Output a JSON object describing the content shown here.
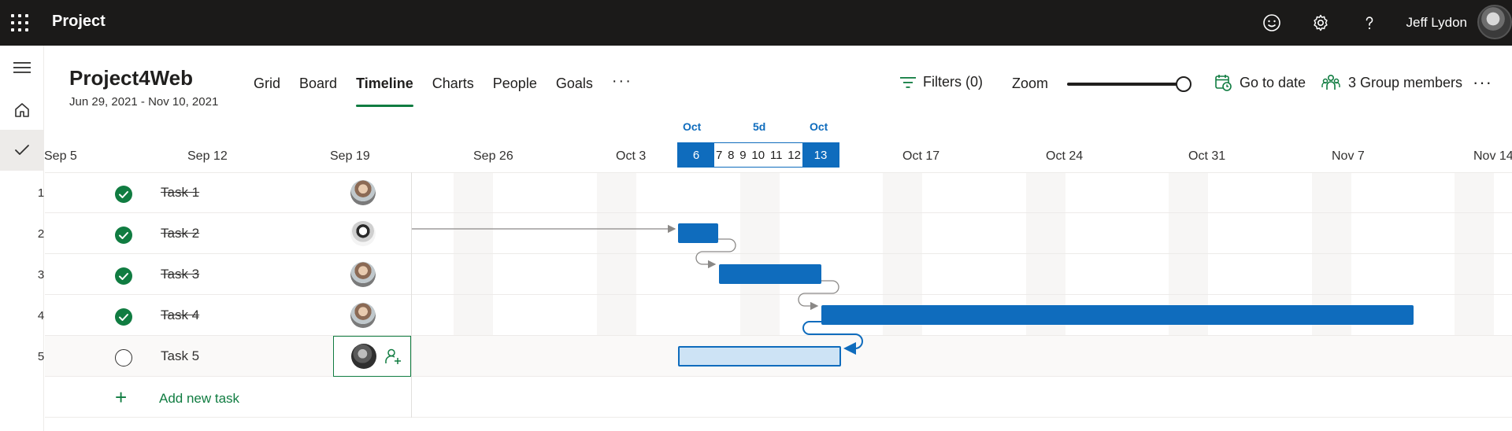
{
  "topbar": {
    "app_title": "Project",
    "user_name": "Jeff Lydon",
    "icons": [
      "waffle-icon",
      "smiley-icon",
      "gear-icon",
      "help-icon"
    ]
  },
  "leftrail": {
    "icons": [
      "hamburger-icon",
      "home-icon",
      "checkmark-icon"
    ]
  },
  "project": {
    "title": "Project4Web",
    "dates": "Jun 29, 2021 - Nov 10, 2021"
  },
  "tabs": [
    {
      "label": "Grid",
      "active": false
    },
    {
      "label": "Board",
      "active": false
    },
    {
      "label": "Timeline",
      "active": true
    },
    {
      "label": "Charts",
      "active": false
    },
    {
      "label": "People",
      "active": false
    },
    {
      "label": "Goals",
      "active": false
    }
  ],
  "more_label": "···",
  "toolbar": {
    "filters_label": "Filters (0)",
    "zoom_label": "Zoom",
    "zoom_level": 1.0,
    "goto_label": "Go to date",
    "members_label": "3 Group members",
    "more_label": "···"
  },
  "timescale": {
    "selection_start_month": "Oct",
    "selection_duration": "5d",
    "selection_end_month": "Oct",
    "selection_start_day": "6",
    "selection_end_day": "13",
    "inner_days": [
      "7",
      "8",
      "9",
      "10",
      "11",
      "12"
    ],
    "weeks": [
      "Sep 5",
      "Sep 12",
      "Sep 19",
      "Sep 26",
      "Oct 3",
      "Oct 17",
      "Oct 24",
      "Oct 31",
      "Nov 7",
      "Nov 14"
    ]
  },
  "tasks": [
    {
      "num": "1",
      "name": "Task 1",
      "completed": true,
      "assignee": "avatar-a"
    },
    {
      "num": "2",
      "name": "Task 2",
      "completed": true,
      "assignee": "avatar-b"
    },
    {
      "num": "3",
      "name": "Task 3",
      "completed": true,
      "assignee": "avatar-a"
    },
    {
      "num": "4",
      "name": "Task 4",
      "completed": true,
      "assignee": "avatar-a"
    },
    {
      "num": "5",
      "name": "Task 5",
      "completed": false,
      "assignee": "avatar-c"
    }
  ],
  "add_task_label": "Add new task",
  "colors": {
    "accent_green": "#107c41",
    "bar_blue": "#0f6cbd",
    "topbar": "#1b1a19"
  }
}
